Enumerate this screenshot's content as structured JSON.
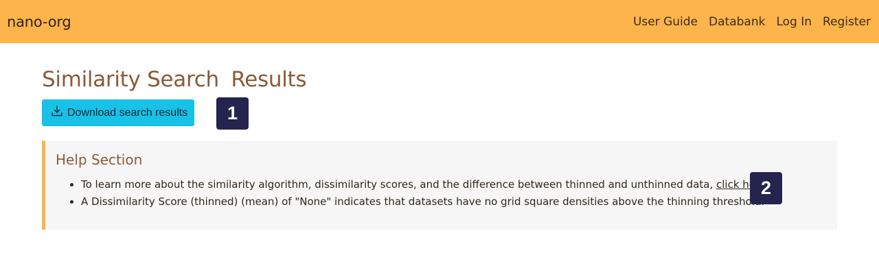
{
  "navbar": {
    "brand": "nano-org",
    "links": [
      "User Guide",
      "Databank",
      "Log In",
      "Register"
    ]
  },
  "page": {
    "title_part1": "Similarity Search",
    "title_part2": "Results"
  },
  "download_button": {
    "label": "Download search results",
    "icon": "download-icon"
  },
  "markers": [
    "1",
    "2"
  ],
  "help": {
    "title": "Help Section",
    "item1_text": "To learn more about the similarity algorithm, dissimilarity scores, and the difference between thinned and unthinned data, ",
    "item1_link": "click here",
    "item1_end": ".",
    "item2_text": "A Dissimilarity Score (thinned) (mean) of \"None\" indicates that datasets have no grid square densities above the thinning threshold."
  },
  "colors": {
    "navbar": "#fdb44b",
    "button": "#17c1e8",
    "title": "#8a5a38",
    "marker": "#24244e",
    "help_bg": "#f6f6f6"
  }
}
